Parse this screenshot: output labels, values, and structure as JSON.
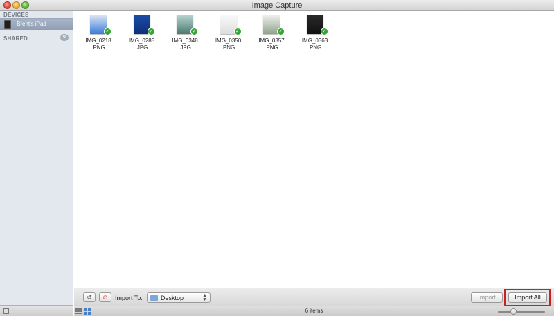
{
  "window": {
    "title": "Image Capture"
  },
  "sidebar": {
    "devices_header": "DEVICES",
    "device_name": "Brent's iPad",
    "shared_header": "SHARED",
    "shared_count": "0"
  },
  "items": [
    {
      "line1": "IMG_0218",
      "line2": ".PNG",
      "colors": [
        "#dfe8f6",
        "#3b7dd8"
      ]
    },
    {
      "line1": "IMG_0285",
      "line2": ".JPG",
      "colors": [
        "#1b4da8",
        "#0f2f78"
      ]
    },
    {
      "line1": "IMG_0348",
      "line2": ".JPG",
      "colors": [
        "#b9d6d2",
        "#4a7a70"
      ]
    },
    {
      "line1": "IMG_0350",
      "line2": ".PNG",
      "colors": [
        "#fafafa",
        "#dddddd"
      ]
    },
    {
      "line1": "IMG_0357",
      "line2": ".PNG",
      "colors": [
        "#f2f2f2",
        "#8fa38a"
      ]
    },
    {
      "line1": "IMG_0363",
      "line2": ".PNG",
      "colors": [
        "#2a2a2a",
        "#111111"
      ]
    }
  ],
  "bottombar": {
    "rotate_label": "↺",
    "delete_label": "⊘",
    "import_to_label": "Import To:",
    "destination": "Desktop",
    "import_label": "Import",
    "import_all_label": "Import All"
  },
  "statusbar": {
    "count_text": "6 items",
    "zoom_level": 0.3
  },
  "colors": {
    "check": "#35a536",
    "highlight": "#cc1f1f",
    "sidebar_bg": "#e3e8ef"
  }
}
